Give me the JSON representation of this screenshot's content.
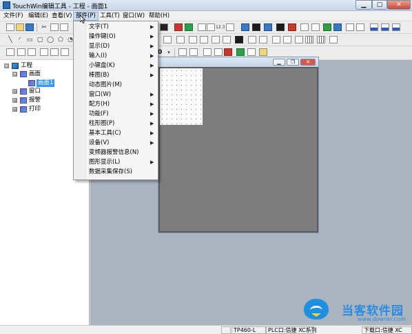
{
  "window": {
    "title": "TouchWin编辑工具 - 工程 - 画面1",
    "minimize_icon": "minimize-icon",
    "maximize_icon": "maximize-icon",
    "close_icon": "close-icon"
  },
  "menubar": {
    "items": [
      "文件(F)",
      "编辑(E)",
      "查看(V)",
      "部件(P)",
      "工具(T)",
      "窗口(W)",
      "帮助(H)"
    ],
    "active": "部件(P)"
  },
  "toolbar": {
    "zoom_value": "0",
    "row2_number_label": "12.3"
  },
  "dropdown": {
    "items": [
      {
        "label": "文字(T)",
        "submenu": true
      },
      {
        "label": "操作键(O)",
        "submenu": true
      },
      {
        "label": "显示(D)",
        "submenu": true
      },
      {
        "label": "输入(I)",
        "submenu": true
      },
      {
        "label": "小键盘(K)",
        "submenu": true
      },
      {
        "label": "棒图(B)",
        "submenu": true
      },
      {
        "label": "动态图片(M)",
        "submenu": false
      },
      {
        "label": "窗口(W)",
        "submenu": true
      },
      {
        "label": "配方(H)",
        "submenu": true
      },
      {
        "label": "功能(F)",
        "submenu": true
      },
      {
        "label": "柱形图(P)",
        "submenu": true
      },
      {
        "label": "基本工具(C)",
        "submenu": true
      },
      {
        "label": "设备(V)",
        "submenu": true
      },
      {
        "label": "变频器报警信息(N)",
        "submenu": false
      },
      {
        "label": "图形显示(L)",
        "submenu": true
      },
      {
        "label": "数据采集保存(S)",
        "submenu": false
      }
    ]
  },
  "project_tree": {
    "root": {
      "label": "工程",
      "toggle": "⊟"
    },
    "children": [
      {
        "label": "画面",
        "toggle": "⊟",
        "children": [
          {
            "label": "画面1",
            "selected": true
          }
        ]
      },
      {
        "label": "窗口",
        "toggle": "⊞"
      },
      {
        "label": "报警",
        "toggle": "⊞"
      },
      {
        "label": "打印",
        "toggle": "⊞"
      }
    ]
  },
  "statusbar": {
    "model": "TP460-L",
    "plc_port": "PLC口:信捷 XC系列",
    "download_port": "下载口:信捷 XC"
  },
  "watermark": {
    "name": "当客软件园",
    "url": "www.downkr.com"
  },
  "colors": {
    "title_bar": "#c8d6e8",
    "menu_active": "#c7daf2",
    "selection": "#3399ff",
    "workspace": "#aab4bf",
    "canvas": "#7d7d7d",
    "watermark": "#2a8be3"
  }
}
